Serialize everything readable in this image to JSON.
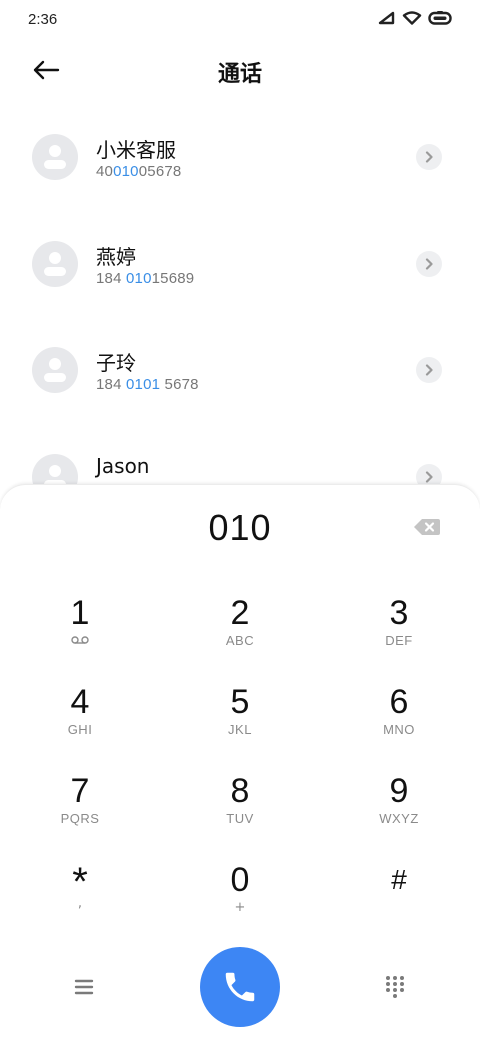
{
  "status_bar": {
    "time": "2:36",
    "icons": [
      "signal-icon",
      "wifi-icon",
      "battery-icon"
    ]
  },
  "header": {
    "back_icon": "back-arrow-icon",
    "title": "通话"
  },
  "contacts": [
    {
      "name": "小米客服",
      "number_parts": [
        "40",
        "010",
        "05678"
      ]
    },
    {
      "name": "燕婷",
      "number_parts": [
        "184 ",
        "010",
        "15689"
      ]
    },
    {
      "name": "子玲",
      "number_parts": [
        "184 ",
        "0101",
        " 5678"
      ]
    },
    {
      "name": "Jason",
      "number_parts": [
        "",
        "",
        ""
      ]
    }
  ],
  "dialer": {
    "dialed_number": "010",
    "backspace_icon": "backspace-icon",
    "keys": [
      {
        "digit": "1",
        "sub": "voicemail-icon"
      },
      {
        "digit": "2",
        "sub": "ABC"
      },
      {
        "digit": "3",
        "sub": "DEF"
      },
      {
        "digit": "4",
        "sub": "GHI"
      },
      {
        "digit": "5",
        "sub": "JKL"
      },
      {
        "digit": "6",
        "sub": "MNO"
      },
      {
        "digit": "7",
        "sub": "PQRS"
      },
      {
        "digit": "8",
        "sub": "TUV"
      },
      {
        "digit": "9",
        "sub": "WXYZ"
      },
      {
        "digit": "*",
        "sub": ","
      },
      {
        "digit": "0",
        "sub": "+"
      },
      {
        "digit": "#",
        "sub": ""
      }
    ]
  },
  "bottom_bar": {
    "menu_icon": "menu-icon",
    "call_icon": "phone-icon",
    "keypad_icon": "keypad-grid-icon"
  },
  "colors": {
    "accent": "#3d86f4",
    "highlight": "#3a8ee6",
    "avatar_bg": "#e7e8eb"
  }
}
